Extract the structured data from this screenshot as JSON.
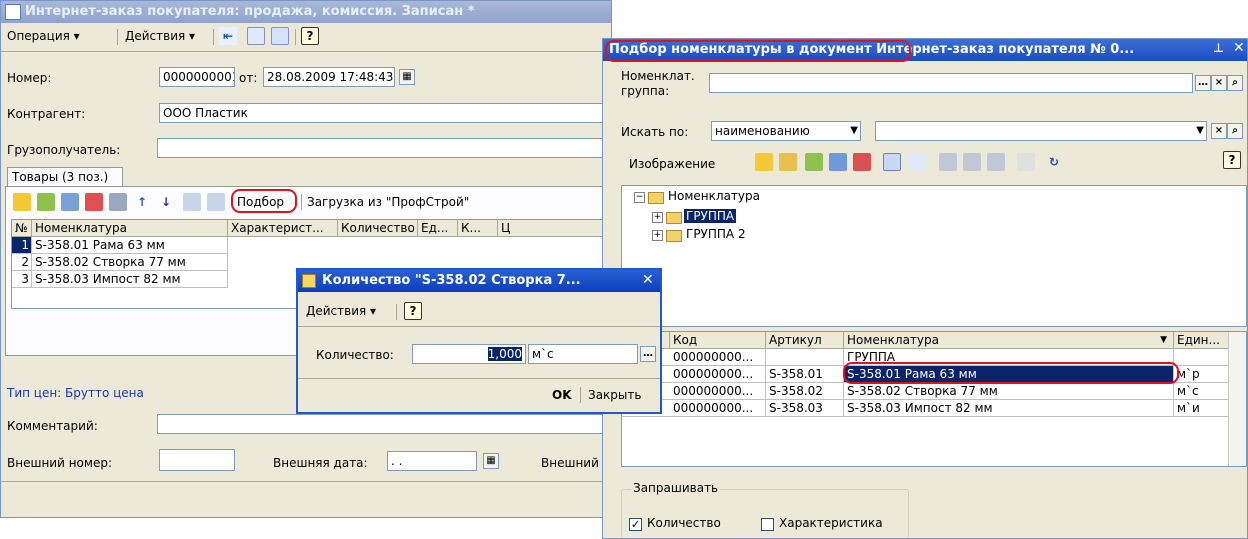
{
  "order_window": {
    "title": "Интернет-заказ покупателя: продажа, комиссия. Записан *",
    "menu": {
      "operation": "Операция",
      "actions": "Действия"
    },
    "fields": {
      "number_label": "Номер:",
      "number_value": "0000000001",
      "from_label": "от:",
      "date_value": "28.08.2009 17:48:43",
      "counterparty_label": "Контрагент:",
      "counterparty_value": "ООО Пластик",
      "consignee_label": "Грузополучатель:"
    },
    "tab_label": "Товары (3 поз.)",
    "toolbar": {
      "podbor": "Подбор",
      "load": "Загрузка из \"ПрофСтрой\""
    },
    "table": {
      "headers": [
        "№",
        "Номенклатура",
        "Характерист...",
        "Количество",
        "Ед...",
        "К...",
        "Ц"
      ],
      "rows": [
        {
          "num": "1",
          "name": "S-358.01 Рама 63 мм"
        },
        {
          "num": "2",
          "name": "S-358.02 Створка 77 мм"
        },
        {
          "num": "3",
          "name": "S-358.03 Импост 82 мм"
        }
      ]
    },
    "price_type": "Тип цен: Брутто цена",
    "comment_label": "Комментарий:",
    "ext_number_label": "Внешний номер:",
    "ext_date_label": "Внешняя дата:",
    "ext_date_value": " .  .",
    "ext_cut_label": "Внешний"
  },
  "qty_dialog": {
    "title": "Количество \"S-358.02 Створка 7...",
    "actions": "Действия",
    "qty_label": "Количество:",
    "qty_value": "1,000",
    "unit_value": "м`с",
    "ok": "OK",
    "close": "Закрыть"
  },
  "pick_window": {
    "title_highlight": "Подбор номенклатуры в документ",
    "title_rest": " Интернет-заказ покупателя № 0...",
    "group_label": "Номенклат. группа:",
    "search_by_label": "Искать по:",
    "search_by_value": "наименованию",
    "image_label": "Изображение",
    "tree": {
      "root": "Номенклатура",
      "group1": "ГРУППА",
      "group2": "ГРУППА 2"
    },
    "table": {
      "headers": [
        "Код",
        "Артикул",
        "Номенклатура",
        "Един..."
      ],
      "rows": [
        {
          "code": "000000000...",
          "art": "",
          "name": "ГРУППА",
          "unit": ""
        },
        {
          "code": "000000000...",
          "art": "S-358.01",
          "name": "S-358.01 Рама 63 мм",
          "unit": "м`р"
        },
        {
          "code": "000000000...",
          "art": "S-358.02",
          "name": "S-358.02 Створка 77 мм",
          "unit": "м`с"
        },
        {
          "code": "000000000...",
          "art": "S-358.03",
          "name": "S-358.03 Импост 82 мм",
          "unit": "м`и"
        }
      ]
    },
    "ask_label": "Запрашивать",
    "ask_qty": "Количество",
    "ask_char": "Характеристика"
  }
}
